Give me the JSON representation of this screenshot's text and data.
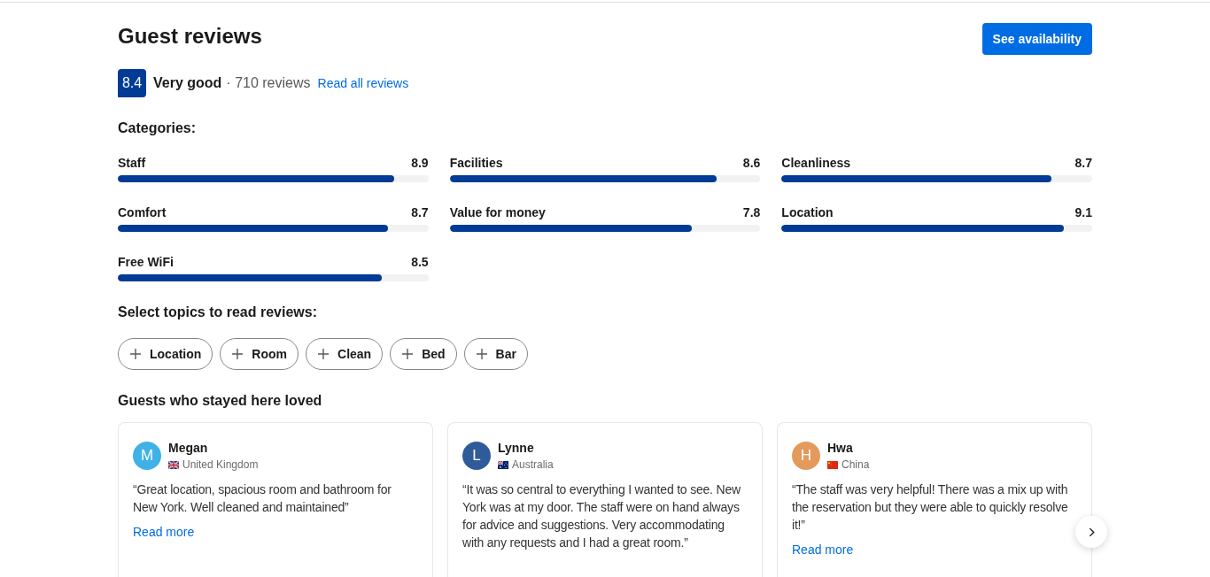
{
  "header": {
    "title": "Guest reviews",
    "button": "See availability"
  },
  "summary": {
    "score": "8.4",
    "rating": "Very good",
    "count": "· 710 reviews",
    "link": "Read all reviews"
  },
  "categories": {
    "heading": "Categories:",
    "items": [
      {
        "name": "Staff",
        "score": "8.9",
        "level": 0.89
      },
      {
        "name": "Facilities",
        "score": "8.6",
        "level": 0.86
      },
      {
        "name": "Cleanliness",
        "score": "8.7",
        "level": 0.87
      },
      {
        "name": "Comfort",
        "score": "8.7",
        "level": 0.87
      },
      {
        "name": "Value for money",
        "score": "7.8",
        "level": 0.78
      },
      {
        "name": "Location",
        "score": "9.1",
        "level": 0.91
      },
      {
        "name": "Free WiFi",
        "score": "8.5",
        "level": 0.85
      }
    ]
  },
  "topics": {
    "heading": "Select topics to read reviews:",
    "chips": [
      {
        "label": "Location",
        "selected": false
      },
      {
        "label": "Room",
        "selected": false
      },
      {
        "label": "Clean",
        "selected": false
      },
      {
        "label": "Bed",
        "selected": false
      },
      {
        "label": "Bar",
        "selected": false
      }
    ]
  },
  "loved": {
    "heading": "Guests who stayed here loved",
    "reviews": [
      {
        "kind": "uk",
        "initial": "M",
        "color": "#3fb1e6",
        "name": "Megan",
        "country": "United Kingdom",
        "quote": "“Great location, spacious room and bathroom for New York. Well cleaned and maintained”",
        "link": "Read more"
      },
      {
        "kind": "australia",
        "initial": "L",
        "color": "#2f5b9a",
        "name": "Lynne",
        "country": "Australia",
        "quote": "“It was so central to everything I wanted to see. New York was at my door. The staff were on hand always for advice and suggestions. Very accommodating with any requests and I had a great room.”"
      },
      {
        "kind": "china",
        "initial": "H",
        "color": "#e49a5c",
        "name": "Hwa",
        "country": "China",
        "quote": "“The staff was very helpful! There was a mix up with the reservation but they were able to quickly resolve it!”",
        "link": "Read more"
      }
    ]
  }
}
